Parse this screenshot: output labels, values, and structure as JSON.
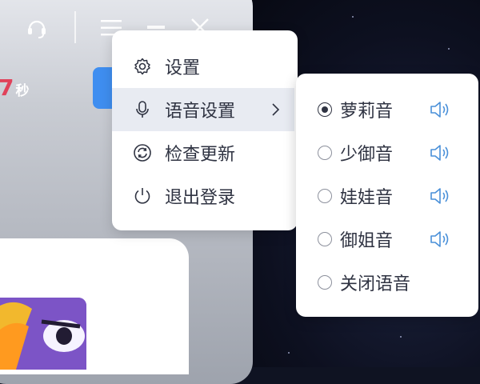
{
  "timer": {
    "value": "7",
    "unit": "秒"
  },
  "menu": {
    "items": [
      {
        "label": "设置",
        "icon": "gear-icon"
      },
      {
        "label": "语音设置",
        "icon": "microphone-icon",
        "active": true,
        "has_submenu": true
      },
      {
        "label": "检查更新",
        "icon": "refresh-icon"
      },
      {
        "label": "退出登录",
        "icon": "power-icon"
      }
    ]
  },
  "voice_submenu": {
    "items": [
      {
        "label": "萝莉音",
        "selected": true,
        "has_preview": true
      },
      {
        "label": "少御音",
        "selected": false,
        "has_preview": true
      },
      {
        "label": "娃娃音",
        "selected": false,
        "has_preview": true
      },
      {
        "label": "御姐音",
        "selected": false,
        "has_preview": true
      },
      {
        "label": "关闭语音",
        "selected": false,
        "has_preview": false
      }
    ]
  },
  "colors": {
    "accent_blue": "#3f8ef0",
    "timer_red": "#e0425a",
    "speaker_blue": "#4a90d9",
    "text": "#2f3342",
    "menu_active_bg": "#e8ebf2"
  }
}
